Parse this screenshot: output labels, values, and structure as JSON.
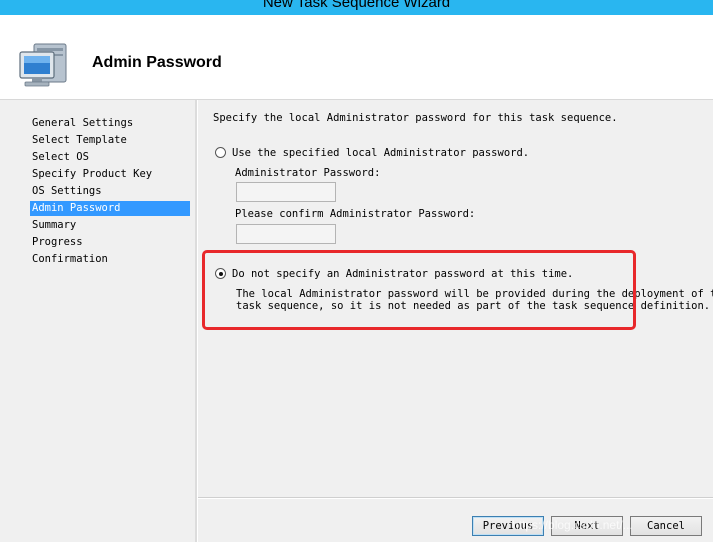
{
  "window": {
    "title": "New Task Sequence Wizard"
  },
  "header": {
    "title": "Admin Password",
    "icon": "computer-icon"
  },
  "sidebar": {
    "items": [
      {
        "label": "General Settings"
      },
      {
        "label": "Select Template"
      },
      {
        "label": "Select OS"
      },
      {
        "label": "Specify Product Key"
      },
      {
        "label": "OS Settings"
      },
      {
        "label": "Admin Password",
        "active": true
      },
      {
        "label": "Summary"
      },
      {
        "label": "Progress"
      },
      {
        "label": "Confirmation"
      }
    ]
  },
  "content": {
    "intro": "Specify the local Administrator password for this task sequence.",
    "option_specify": {
      "label": "Use the specified local Administrator password.",
      "checked": false,
      "password_label": "Administrator Password:",
      "password_value": "",
      "confirm_label": "Please confirm Administrator Password:",
      "confirm_value": ""
    },
    "option_none": {
      "label": "Do not specify an Administrator password at this time.",
      "checked": true,
      "description_line1": "The local Administrator password will be provided during the deployment of this",
      "description_line2": "task sequence, so it is not needed as part of the task sequence definition."
    }
  },
  "buttons": {
    "previous": "Previous",
    "next": "Next",
    "cancel": "Cancel"
  },
  "colors": {
    "titlebar": "#29b6f0",
    "selection": "#3399ff",
    "highlight_box": "#e8282b"
  },
  "watermark": "https://blog.csdn.net/..."
}
